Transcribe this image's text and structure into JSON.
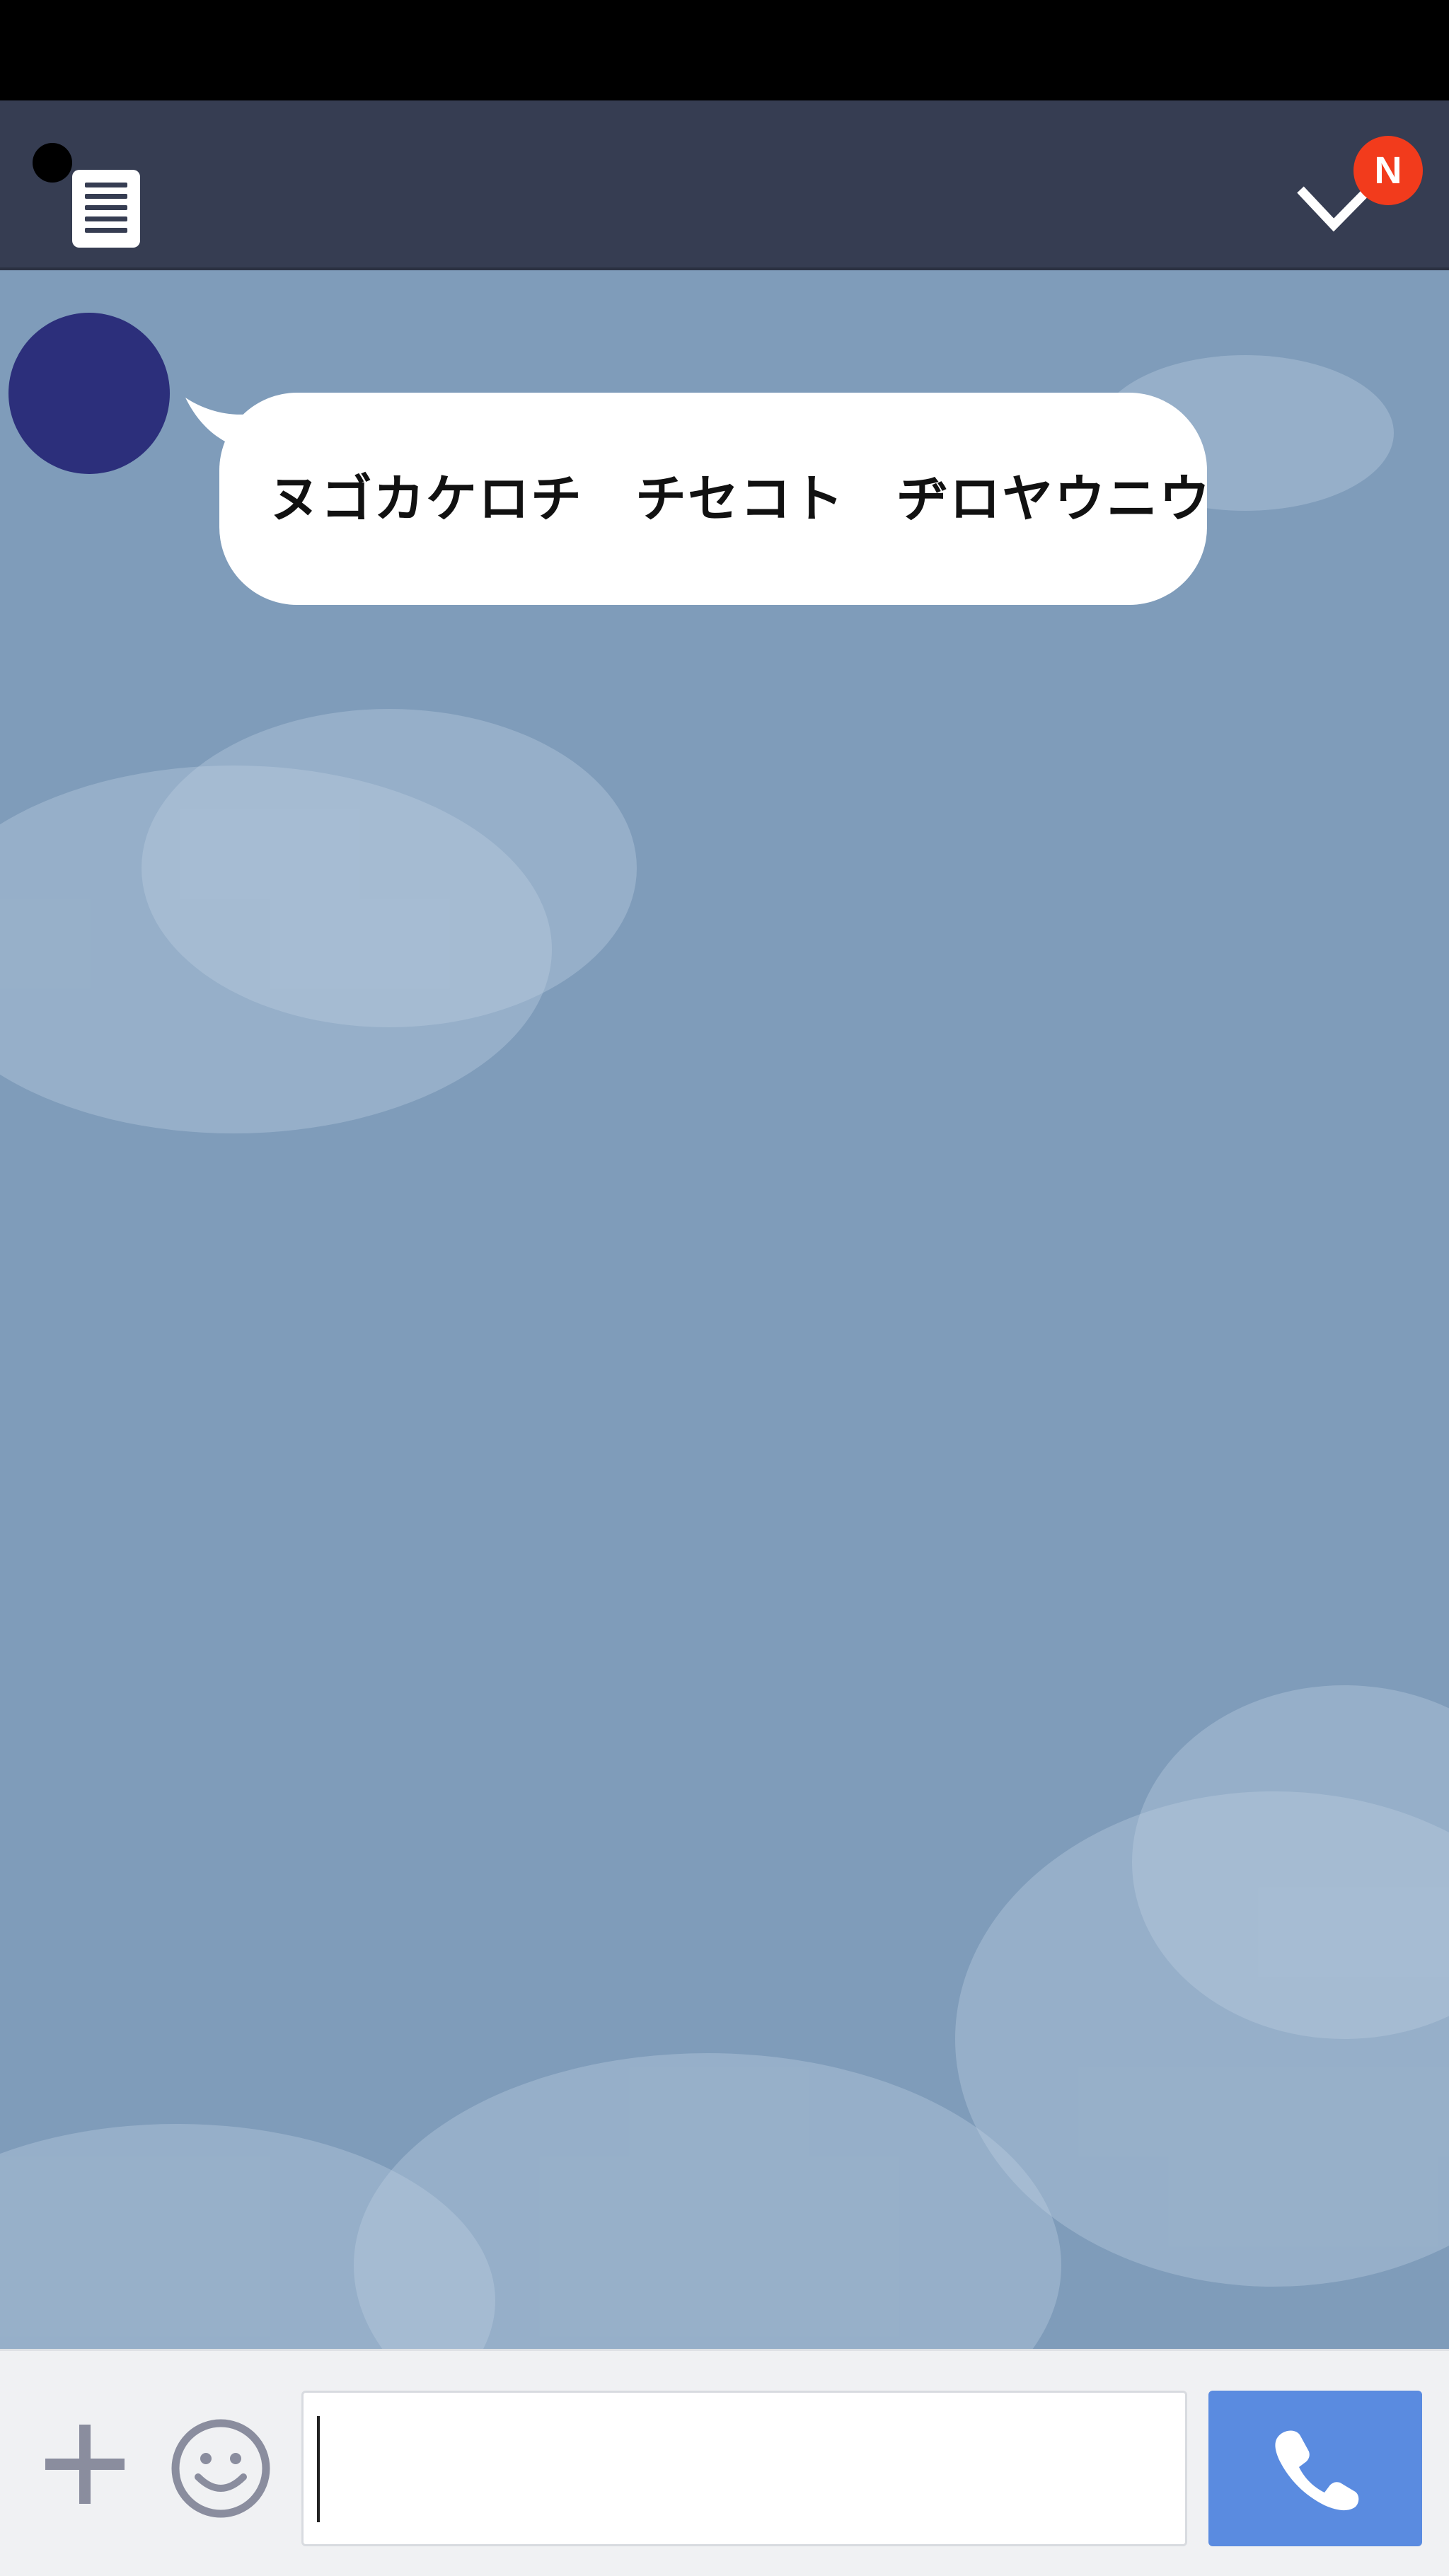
{
  "header": {
    "menu_icon": "menu-list-icon",
    "check_icon": "checkmark-chevron-icon",
    "notification_badge": "N"
  },
  "chat": {
    "messages": [
      {
        "from": "other",
        "text": "ヌゴカケロチ　チセコト　ヂロヤウニウ"
      }
    ]
  },
  "composer": {
    "add_icon": "plus-icon",
    "emoji_icon": "smiley-icon",
    "input_value": "",
    "call_icon": "phone-icon"
  },
  "colors": {
    "header_bg": "#363d52",
    "chat_bg": "#7f9cba",
    "badge": "#f23b1c",
    "avatar": "#2c2f7b",
    "call_button": "#5a8be0"
  }
}
